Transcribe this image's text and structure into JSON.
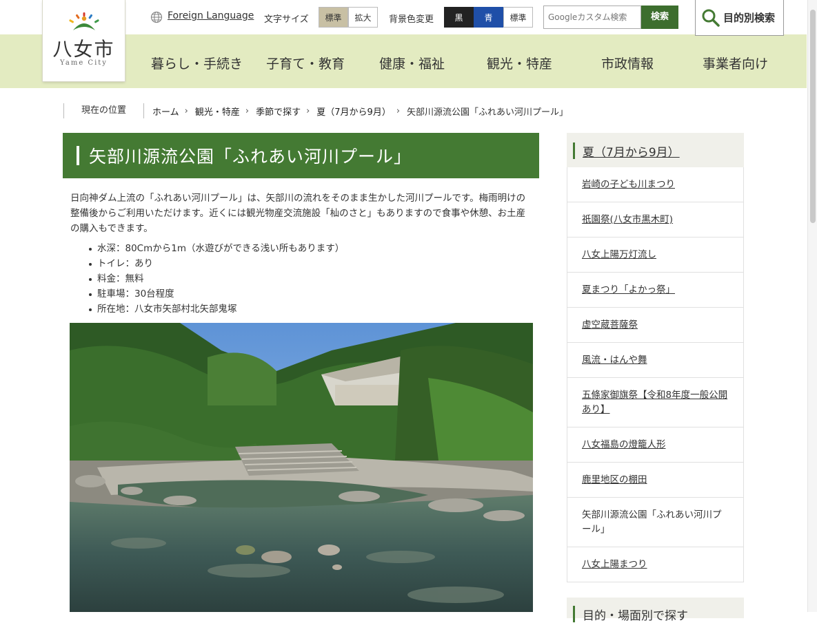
{
  "logo": {
    "title": "八女市",
    "subtitle": "Yame City"
  },
  "utility": {
    "foreign_language": "Foreign Language",
    "font_size_label": "文字サイズ",
    "font_size_standard": "標準",
    "font_size_large": "拡大",
    "bg_color_label": "背景色変更",
    "bg_black": "黒",
    "bg_blue": "青",
    "bg_standard": "標準",
    "search_placeholder": "Googleカスタム検索",
    "search_button": "検索",
    "purpose_search": "目的別検索"
  },
  "nav": [
    {
      "label": "暮らし・手続き"
    },
    {
      "label": "子育て・教育"
    },
    {
      "label": "健康・福祉"
    },
    {
      "label": "観光・特産"
    },
    {
      "label": "市政情報"
    },
    {
      "label": "事業者向け"
    }
  ],
  "breadcrumb": {
    "label": "現在の位置",
    "items": [
      "ホーム",
      "観光・特産",
      "季節で探す",
      "夏（7月から9月）"
    ],
    "current": "矢部川源流公園「ふれあい河川プール」"
  },
  "article": {
    "title": "矢部川源流公園「ふれあい河川プール」",
    "lead": "日向神ダム上流の「ふれあい河川プール」は、矢部川の流れをそのまま生かした河川プールです。梅雨明けの整備後からご利用いただけます。近くには観光物産交流施設「杣のさと」もありますので食事や休憩、お土産の購入もできます。",
    "facts": [
      "水深：80Cmから1m（水遊びができる浅い所もあります）",
      "トイレ：あり",
      "料金：無料",
      "駐車場：30台程度",
      "所在地：八女市矢部村北矢部鬼塚"
    ]
  },
  "sidebar": {
    "heading": "夏（7月から9月）",
    "items": [
      "岩崎の子ども川まつり",
      "祇園祭(八女市黒木町)",
      "八女上陽万灯流し",
      "夏まつり「よかっ祭」",
      "虚空蔵菩薩祭",
      "風流・はんや舞",
      "五條家御旗祭【令和8年度一般公開あり】",
      "八女福島の燈籠人形",
      "鹿里地区の棚田",
      "矢部川源流公園「ふれあい河川プール」",
      "八女上陽まつり"
    ],
    "current_index": 9,
    "next_heading": "目的・場面別で探す"
  },
  "colors": {
    "brand_green": "#447a33",
    "nav_band": "#e3ebc1",
    "search_green": "#3d6e2e"
  }
}
